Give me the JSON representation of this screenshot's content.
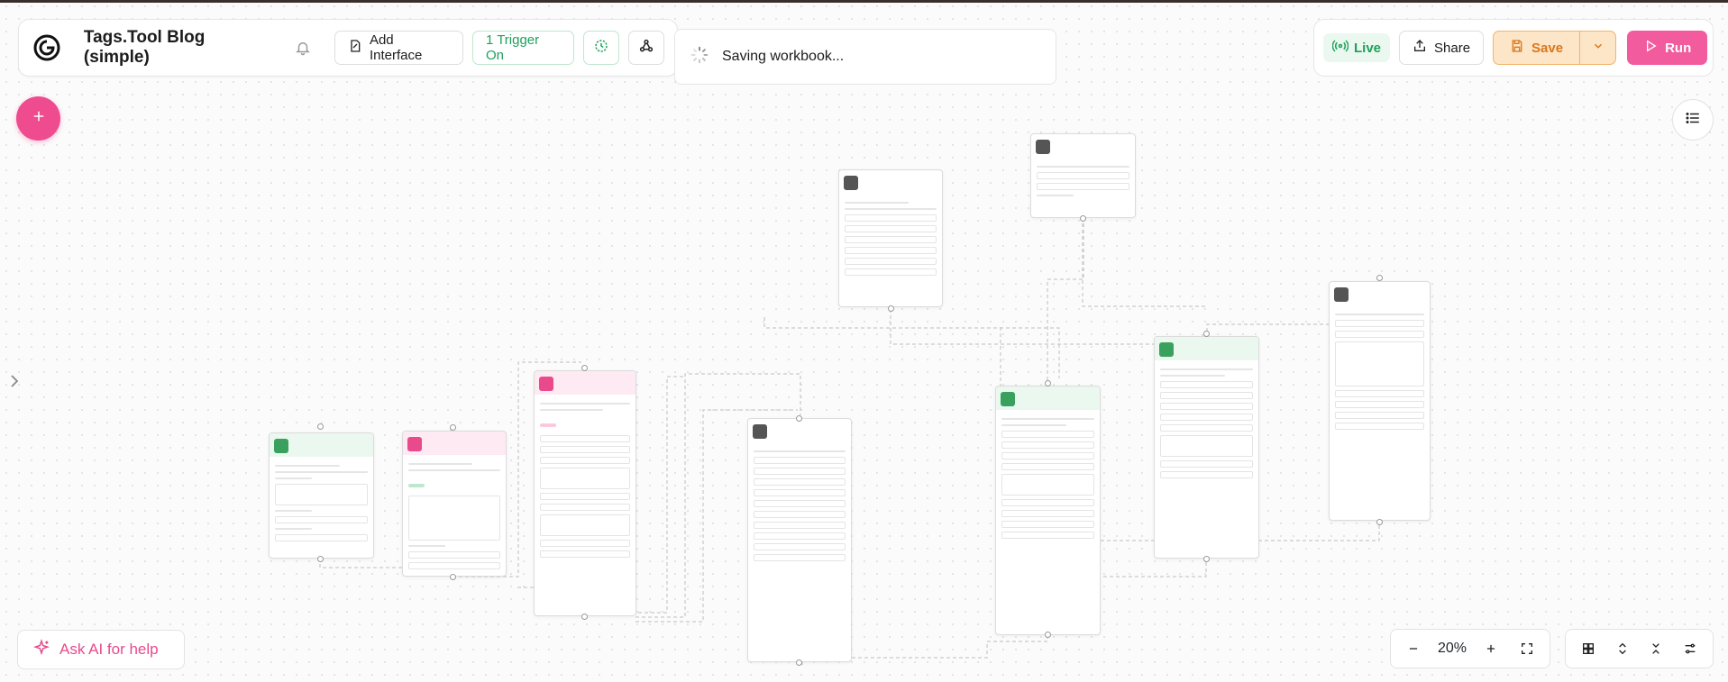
{
  "workflow": {
    "title": "Tags.Tool Blog (simple)"
  },
  "toolbar": {
    "add_interface_label": "Add Interface",
    "trigger_label": "1 Trigger On"
  },
  "toast": {
    "text": "Saving workbook..."
  },
  "actions": {
    "live_label": "Live",
    "share_label": "Share",
    "save_label": "Save",
    "run_label": "Run"
  },
  "assistant": {
    "label": "Ask AI for help"
  },
  "zoom": {
    "level": "20%"
  },
  "colors": {
    "accent_pink": "#ef4b8f",
    "live_green": "#1fa05b",
    "save_orange": "#d9771b"
  },
  "icons": {
    "logo": "logo-icon",
    "bell": "bell-icon",
    "interface": "interface-icon",
    "history": "history-icon",
    "webhook": "webhook-icon",
    "share": "share-icon",
    "save": "save-icon",
    "run": "play-icon",
    "add": "plus-icon",
    "list": "list-icon",
    "sparkle": "sparkle-icon"
  }
}
